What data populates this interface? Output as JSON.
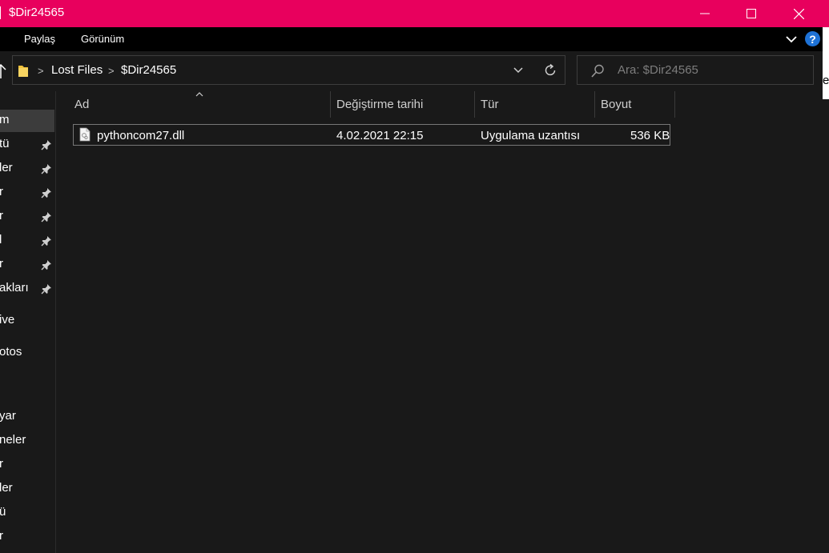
{
  "window": {
    "title": "$Dir24565"
  },
  "ribbon": {
    "tabs": [
      "Paylaş",
      "Görünüm"
    ],
    "help_label": "?"
  },
  "address": {
    "breadcrumb": [
      "Lost Files",
      "$Dir24565"
    ],
    "search_placeholder": "Ara: $Dir24565"
  },
  "edge": {
    "letter": "e"
  },
  "nav": {
    "items": [
      {
        "label": "m",
        "pinned": false,
        "selected": true
      },
      {
        "label": "tü",
        "pinned": true
      },
      {
        "label": "ler",
        "pinned": true
      },
      {
        "label": "r",
        "pinned": true
      },
      {
        "label": "r",
        "pinned": true
      },
      {
        "label": "l",
        "pinned": true
      },
      {
        "label": "r",
        "pinned": true
      },
      {
        "label": "akları",
        "pinned": true
      },
      {
        "label": "ive",
        "pinned": false
      },
      {
        "label": "otos",
        "pinned": false
      },
      {
        "label": "yar",
        "pinned": false
      },
      {
        "label": "neler",
        "pinned": false
      },
      {
        "label": "r",
        "pinned": false
      },
      {
        "label": "ler",
        "pinned": false
      },
      {
        "label": "ü",
        "pinned": false
      },
      {
        "label": "r",
        "pinned": false
      }
    ]
  },
  "columns": [
    "Ad",
    "Değiştirme tarihi",
    "Tür",
    "Boyut"
  ],
  "files": [
    {
      "name": "pythoncom27.dll",
      "modified": "4.02.2021 22:15",
      "type": "Uygulama uzantısı",
      "size": "536 KB",
      "icon": "dll-file-icon"
    }
  ],
  "colors": {
    "titlebar": "#e8005d",
    "background": "#191919",
    "help": "#1e72d6"
  }
}
